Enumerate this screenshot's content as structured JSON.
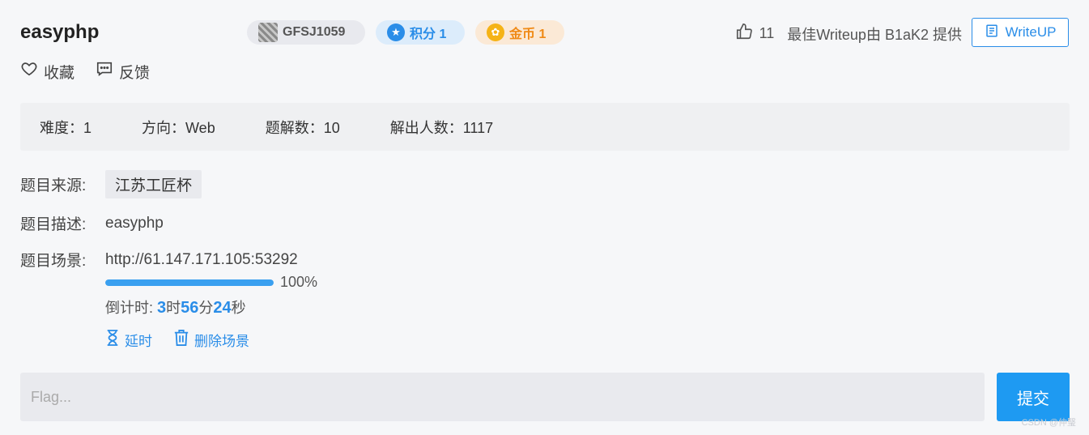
{
  "header": {
    "title": "easyphp",
    "badges": {
      "id": "GFSJ1059",
      "score": "积分 1",
      "gold": "金币 1"
    },
    "likes": "11",
    "writeup_text": "最佳Writeup由 B1aK2 提供",
    "writeup_button": "WriteUP"
  },
  "actions": {
    "favorite": "收藏",
    "feedback": "反馈"
  },
  "info": {
    "difficulty": "难度：1",
    "direction": "方向：Web",
    "solutions": "题解数：10",
    "solvers": "解出人数：1117"
  },
  "details": {
    "source_label": "题目来源:",
    "source_value": "江苏工匠杯",
    "desc_label": "题目描述:",
    "desc_value": "easyphp",
    "scene_label": "题目场景:",
    "scene_url": "http://61.147.171.105:53292",
    "progress_text": "100%",
    "progress": 1.0,
    "countdown_prefix": "倒计时: ",
    "hours": "3",
    "hours_unit": "时",
    "minutes": "56",
    "minutes_unit": "分",
    "seconds": "24",
    "seconds_unit": "秒",
    "extend": "延时",
    "delete_scene": "删除场景"
  },
  "flag": {
    "placeholder": "Flag...",
    "submit": "提交"
  },
  "watermark": "CSDN @仲瑿",
  "colors": {
    "accent": "#2a8de8",
    "submit": "#1e9af2"
  }
}
